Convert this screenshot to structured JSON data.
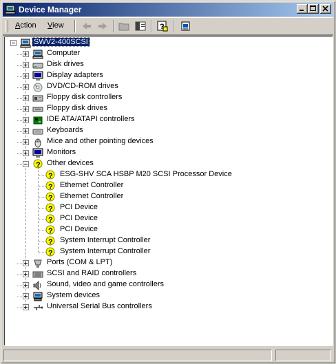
{
  "window": {
    "title": "Device Manager"
  },
  "menu": {
    "action": {
      "label_prefix": "",
      "label_accel": "A",
      "label_rest": "ction"
    },
    "view": {
      "label_prefix": "",
      "label_accel": "V",
      "label_rest": "iew"
    }
  },
  "toolbar": {
    "icons": [
      "back-arrow-icon",
      "forward-arrow-icon",
      "up-folder-icon",
      "show-hide-tree-icon",
      "help-icon",
      "properties-icon"
    ]
  },
  "tree": {
    "root": {
      "label": "SWV2-400SCSI",
      "icon": "computer-icon",
      "selected": true
    },
    "categories": [
      {
        "label": "Computer",
        "icon": "computer-icon",
        "expanded": false
      },
      {
        "label": "Disk drives",
        "icon": "disk-drive-icon",
        "expanded": false
      },
      {
        "label": "Display adapters",
        "icon": "monitor-icon",
        "expanded": false
      },
      {
        "label": "DVD/CD-ROM drives",
        "icon": "cdrom-icon",
        "expanded": false
      },
      {
        "label": "Floppy disk controllers",
        "icon": "floppy-controller-icon",
        "expanded": false
      },
      {
        "label": "Floppy disk drives",
        "icon": "floppy-drive-icon",
        "expanded": false
      },
      {
        "label": "IDE ATA/ATAPI controllers",
        "icon": "ide-controller-icon",
        "expanded": false
      },
      {
        "label": "Keyboards",
        "icon": "keyboard-icon",
        "expanded": false
      },
      {
        "label": "Mice and other pointing devices",
        "icon": "mouse-icon",
        "expanded": false
      },
      {
        "label": "Monitors",
        "icon": "monitor-icon",
        "expanded": false
      },
      {
        "label": "Other devices",
        "icon": "unknown-device-icon",
        "expanded": true,
        "children": [
          {
            "label": "ESG-SHV SCA HSBP M20 SCSI Processor Device",
            "icon": "unknown-device-icon"
          },
          {
            "label": "Ethernet Controller",
            "icon": "unknown-device-icon"
          },
          {
            "label": "Ethernet Controller",
            "icon": "unknown-device-icon"
          },
          {
            "label": "PCI Device",
            "icon": "unknown-device-icon"
          },
          {
            "label": "PCI Device",
            "icon": "unknown-device-icon"
          },
          {
            "label": "PCI Device",
            "icon": "unknown-device-icon"
          },
          {
            "label": "System Interrupt Controller",
            "icon": "unknown-device-icon"
          },
          {
            "label": "System Interrupt Controller",
            "icon": "unknown-device-icon"
          }
        ]
      },
      {
        "label": "Ports (COM & LPT)",
        "icon": "port-icon",
        "expanded": false
      },
      {
        "label": "SCSI and RAID controllers",
        "icon": "scsi-icon",
        "expanded": false
      },
      {
        "label": "Sound, video and game controllers",
        "icon": "speaker-icon",
        "expanded": false
      },
      {
        "label": "System devices",
        "icon": "system-device-icon",
        "expanded": false
      },
      {
        "label": "Universal Serial Bus controllers",
        "icon": "usb-icon",
        "expanded": false
      }
    ]
  },
  "colors": {
    "titlebar_start": "#0a246a",
    "titlebar_end": "#a6caf0",
    "selection": "#0a246a",
    "warning_yellow": "#ffff00"
  }
}
